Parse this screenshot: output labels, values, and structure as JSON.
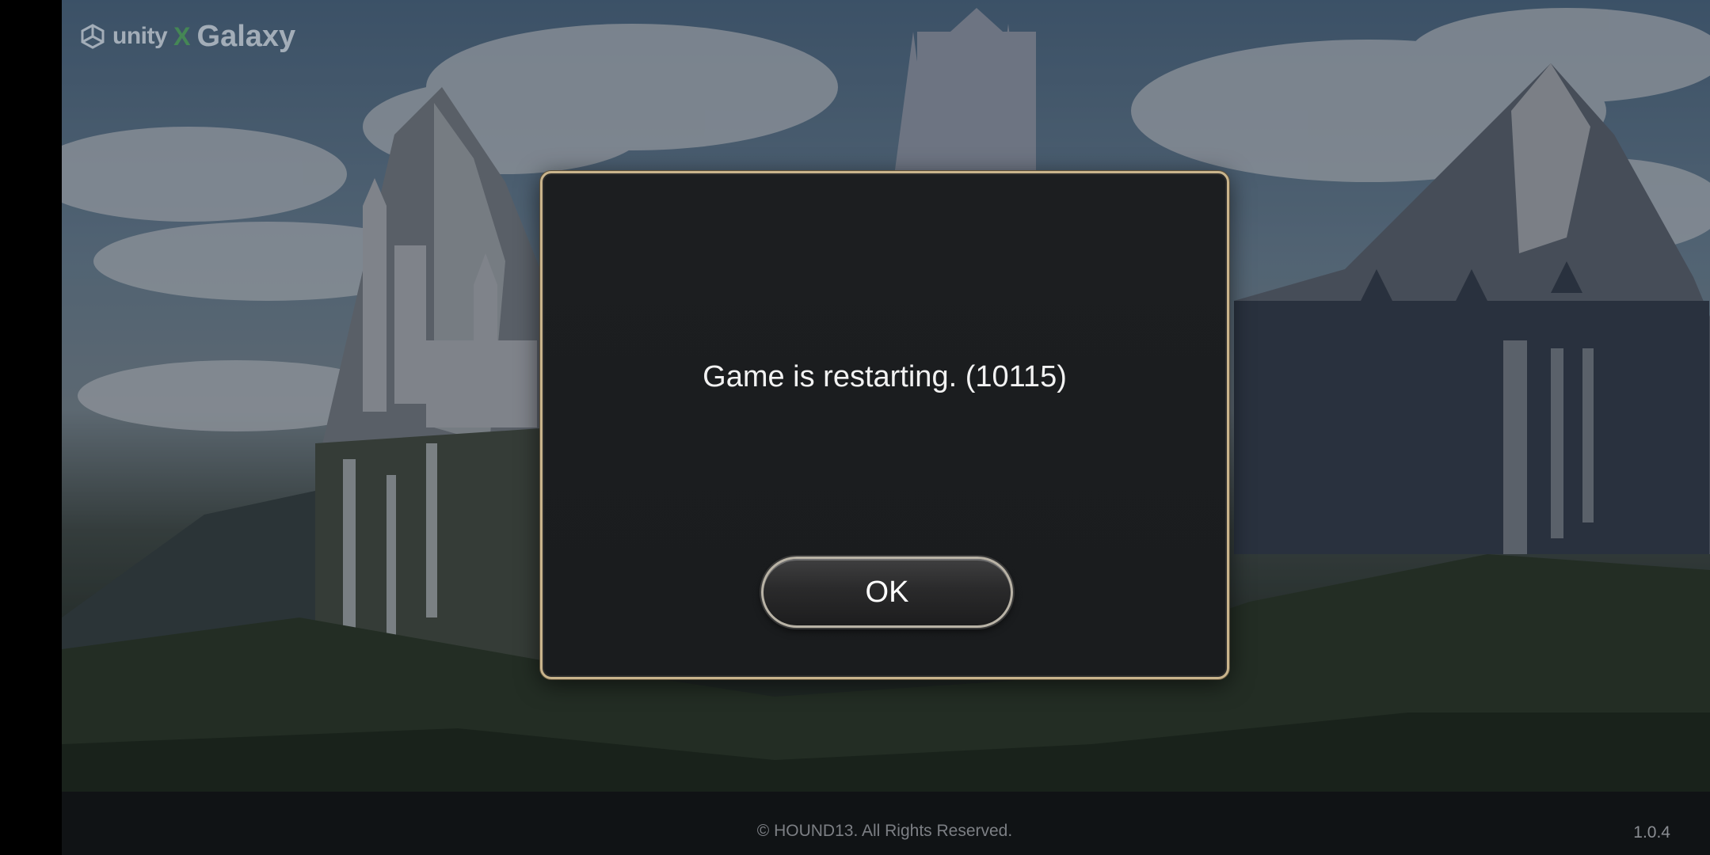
{
  "logo": {
    "unity_text": "unity",
    "x_mark": "X",
    "galaxy_text": "Galaxy"
  },
  "dialog": {
    "message": "Game is restarting. (10115)",
    "ok_label": "OK"
  },
  "footer": {
    "copyright": "© HOUND13. All Rights Reserved.",
    "version": "1.0.4"
  },
  "colors": {
    "dialog_border": "#c9b48c",
    "dialog_bg": "#1b1d1f",
    "button_border": "#b9b3a6"
  }
}
